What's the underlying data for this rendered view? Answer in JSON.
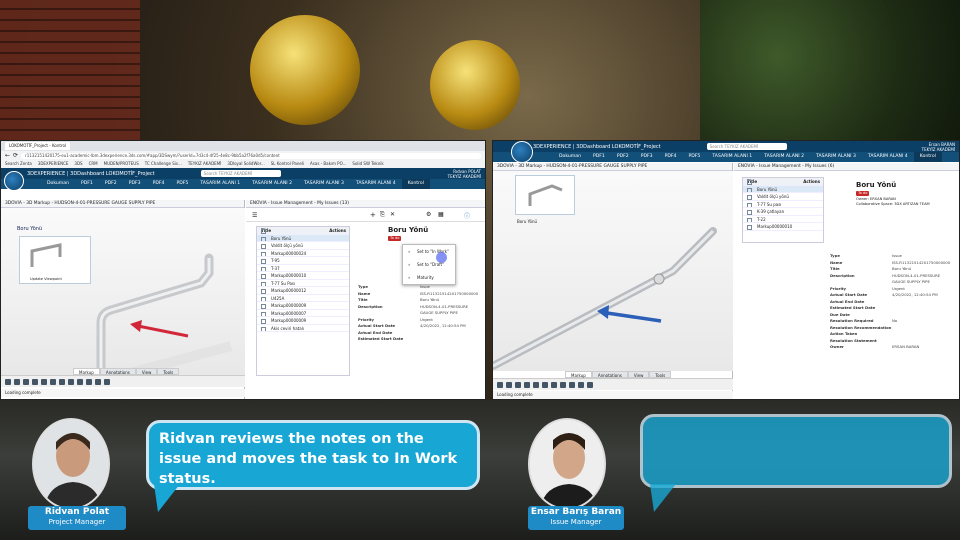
{
  "left_window": {
    "browser_tab": "LOKOMOTİF_Project - Kontrol",
    "url": "r1132151420175-eu1-academic-lbm.3dexperience.3ds.com/#app/3DSwym/?userId=7d3c4-4f25-4e8c-9bb5a2f76a0d5/content",
    "bookmarks": [
      "Search Zenta",
      "3DEXPERIENCE",
      "3DS",
      "CRM",
      "MUDEN/PROTEUS",
      "TC Challenge Sis...",
      "TEYKIZ AKADEMİ",
      "3Dloyal SolidWor...",
      "SL Kontrol Paneli",
      "Asas - Bakım PO...",
      "Solid SW Teknik"
    ],
    "app_title": "3DEXPERIENCE | 3DDashboard LOKOMOTİF_Project",
    "search_placeholder": "Search TEYKIZ AKADEMİ",
    "user": "Rıdvan POLAT",
    "org": "TEKYİZ AKADEMİ",
    "nav_tabs": [
      "Dokuman",
      "PDF1",
      "PDF2",
      "PDF3",
      "PDF4",
      "PDF5",
      "TASARIM ALANI 1",
      "TASARIM ALANI 2",
      "TASARIM ALANI 3",
      "TASARIM ALANI 4",
      "Kontrol"
    ],
    "markup_title": "3DOVIA - 3D Markup - HUDSON-4-01-PRESSURE GAUGE SUPPLY PIPE",
    "tree_label": "Boru Yönü",
    "tree_thumb_label": "Update Viewpoint",
    "bottom_tabs": [
      "Markup",
      "Annotations",
      "View",
      "Tools"
    ],
    "status": "Loading complete",
    "issue_title": "ENOVIA - Issue Management - My Issues (13)",
    "issue_list": [
      "Boru Yönü",
      "Valdit ölçü yönü",
      "Markup00000024",
      "T-95",
      "T-37",
      "Markup00000010",
      "T-77 Su Pası",
      "Markup00000012",
      "U425A",
      "Markup00000009",
      "Markup00000007",
      "Markup00000009",
      "Akis ceviri hatalı"
    ],
    "list_col_title": "Title",
    "list_col_actions": "Actions",
    "issue_name": "Boru Yönü",
    "issue_badge": "To do",
    "menu_items": [
      "Set to \"In Work\"",
      "Set to \"Draft\"",
      "Maturity"
    ],
    "details": [
      {
        "k": "Type",
        "v": "Issue"
      },
      {
        "k": "Name",
        "v": "ISS-R11321514201750000000"
      },
      {
        "k": "Title",
        "v": "Boru Yönü"
      },
      {
        "k": "Description",
        "v": "HUDSON-4-01-PRESSURE GAUGE SUPPLY PIPE"
      },
      {
        "k": "Priority",
        "v": "Urgent"
      },
      {
        "k": "Actual Start Date",
        "v": "4/20/2022, 12:40:54 PM"
      },
      {
        "k": "Actual End Date",
        "v": ""
      },
      {
        "k": "Estimated Start Date",
        "v": ""
      }
    ]
  },
  "right_window": {
    "app_title": "3DEXPERIENCE | 3DDashboard LOKOMOTİF_Project",
    "search_placeholder": "Search TEYKIZ AKADEMİ",
    "user": "Ersan BARAN",
    "org": "TEKYİZ AKADEMİ",
    "nav_tabs": [
      "Dokuman",
      "PDF1",
      "PDF2",
      "PDF3",
      "PDF4",
      "PDF5",
      "TASARIM ALANI 1",
      "TASARIM ALANI 2",
      "TASARIM ALANI 3",
      "TASARIM ALANI 4",
      "Kontrol"
    ],
    "markup_title": "3DOVIA - 3D Markup - HUDSON-4-01-PRESSURE GAUGE SUPPLY PIPE",
    "tree_label": "Boru Yönü",
    "bottom_tabs": [
      "Markup",
      "Annotations",
      "View",
      "Tools"
    ],
    "status": "Loading complete",
    "issue_title": "ENOVIA - Issue Management - My Issues (6)",
    "issue_list": [
      "Boru Yönü",
      "Valdit ölçü yönü",
      "T-77 Su pası",
      "K-39 çatlayan",
      "T-22",
      "Markup00000010"
    ],
    "list_col_title": "Title",
    "list_col_actions": "Actions",
    "issue_name": "Boru Yönü",
    "issue_badge": "To do",
    "owner_line": "Owner: ERSAN BARAN",
    "collab_line": "Collaborative Space: 3DX ARTIZAN TEAM",
    "details": [
      {
        "k": "Type",
        "v": "Issue"
      },
      {
        "k": "Name",
        "v": "ISS-R11321514201750000000"
      },
      {
        "k": "Title",
        "v": "Boru Yönü"
      },
      {
        "k": "Description",
        "v": "HUDSON-4-01-PRESSURE GAUGE SUPPLY PIPE"
      },
      {
        "k": "Priority",
        "v": "Urgent"
      },
      {
        "k": "Actual Start Date",
        "v": "4/20/2022, 12:40:54 PM"
      },
      {
        "k": "Actual End Date",
        "v": ""
      },
      {
        "k": "Estimated Start Date",
        "v": ""
      },
      {
        "k": "Due Date",
        "v": ""
      },
      {
        "k": "Resolution Required",
        "v": "No"
      },
      {
        "k": "Resolution Recommendation",
        "v": ""
      },
      {
        "k": "Action Taken",
        "v": ""
      },
      {
        "k": "Resolution Statement",
        "v": ""
      },
      {
        "k": "Owner",
        "v": "ERSAN BARAN"
      }
    ]
  },
  "speaker_left": {
    "name": "Ridvan Polat",
    "role": "Project Manager",
    "speech": "Ridvan reviews the notes on the issue and moves the task to In Work status."
  },
  "speaker_right": {
    "name": "Ensar Barış Baran",
    "role": "Issue Manager",
    "speech": ""
  },
  "colors": {
    "accent_blue": "#1e8ac6",
    "bubble_blue": "#18a7d4",
    "dashboard_bar": "#0b3f66",
    "arrow_red": "#d0283a",
    "arrow_blue": "#2c5fb8"
  }
}
